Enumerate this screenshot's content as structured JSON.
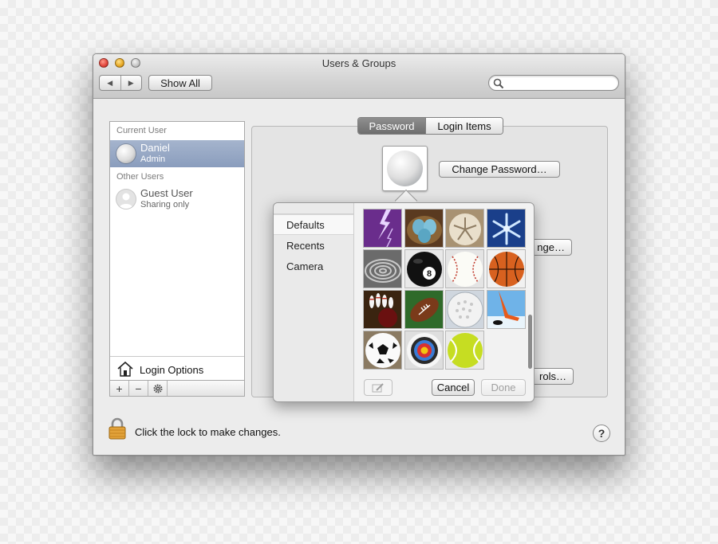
{
  "window": {
    "title": "Users & Groups",
    "nav_back_glyph": "◀",
    "nav_forward_glyph": "▶",
    "show_all_label": "Show All",
    "search": {
      "value": "",
      "placeholder": ""
    }
  },
  "sidebar": {
    "current_user_header": "Current User",
    "current_user": {
      "name": "Daniel",
      "role": "Admin",
      "avatar": "golf-ball-icon"
    },
    "other_users_header": "Other Users",
    "other_users": [
      {
        "name": "Guest User",
        "role": "Sharing only",
        "avatar": "person-silhouette-icon"
      }
    ],
    "login_options_label": "Login Options",
    "footer": {
      "add_glyph": "+",
      "remove_glyph": "−",
      "action_icon": "gear-icon"
    }
  },
  "tabs": [
    {
      "label": "Password",
      "active": true
    },
    {
      "label": "Login Items",
      "active": false
    }
  ],
  "main": {
    "change_password_label": "Change Password…",
    "obscured_button_1_text": "nge…",
    "obscured_button_2_text": "rols…"
  },
  "footer": {
    "lock_text": "Click the lock to make changes.",
    "help_label": "?"
  },
  "picture_popover": {
    "sources": [
      "Defaults",
      "Recents",
      "Camera"
    ],
    "selected_source": "Defaults",
    "pictures": [
      "lightning-icon",
      "eggs-in-nest-icon",
      "sand-dollar-icon",
      "snowflake-icon",
      "zen-sand-spiral-icon",
      "eight-ball-icon",
      "baseball-icon",
      "basketball-icon",
      "bowling-icon",
      "football-icon",
      "golf-ball-icon",
      "hockey-icon",
      "soccer-ball-icon",
      "target-icon",
      "tennis-ball-icon"
    ],
    "cancel_label": "Cancel",
    "done_label": "Done"
  },
  "colors": {
    "selection_blue": "#8a9dbd",
    "active_tab": "#7a7a7a",
    "window_bg": "#ececec"
  }
}
